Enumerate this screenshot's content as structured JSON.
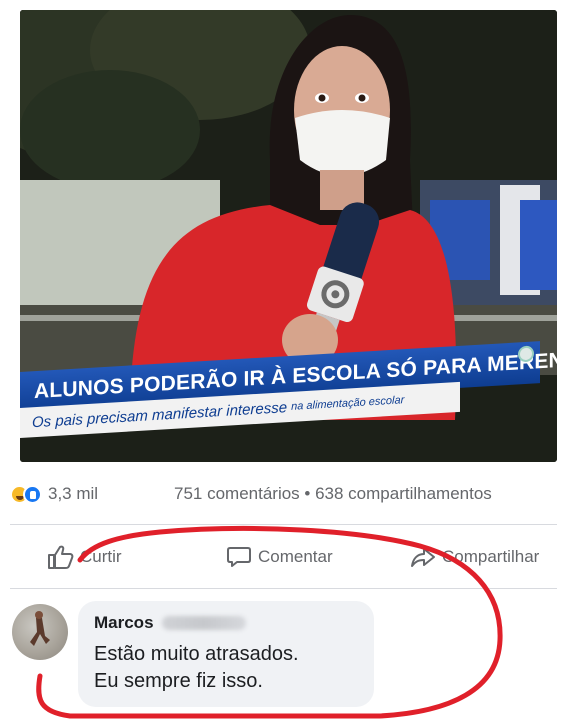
{
  "video": {
    "headline": "ALUNOS PODERÃO IR À ESCOLA SÓ PARA MERENDAR",
    "subtitle_main": "Os pais precisam manifestar interesse",
    "subtitle_small": "na alimentação escolar"
  },
  "stats": {
    "reaction_icons": [
      "haha-reaction-icon",
      "like-reaction-icon"
    ],
    "reaction_count": "3,3 mil",
    "comments_shares": "751 comentários • 638 compartilhamentos"
  },
  "actions": {
    "like_label": "Curtir",
    "comment_label": "Comentar",
    "share_label": "Compartilhar"
  },
  "comment": {
    "author": "Marcos",
    "lines": [
      "Estão muito atrasados.",
      "Eu sempre fiz isso."
    ]
  },
  "colors": {
    "headline_blue": "#0e3d91",
    "reporter_red": "#d8262a",
    "annotation_red": "#e0202a",
    "secondary_text": "#65676b",
    "bubble_bg": "#f0f2f5"
  }
}
